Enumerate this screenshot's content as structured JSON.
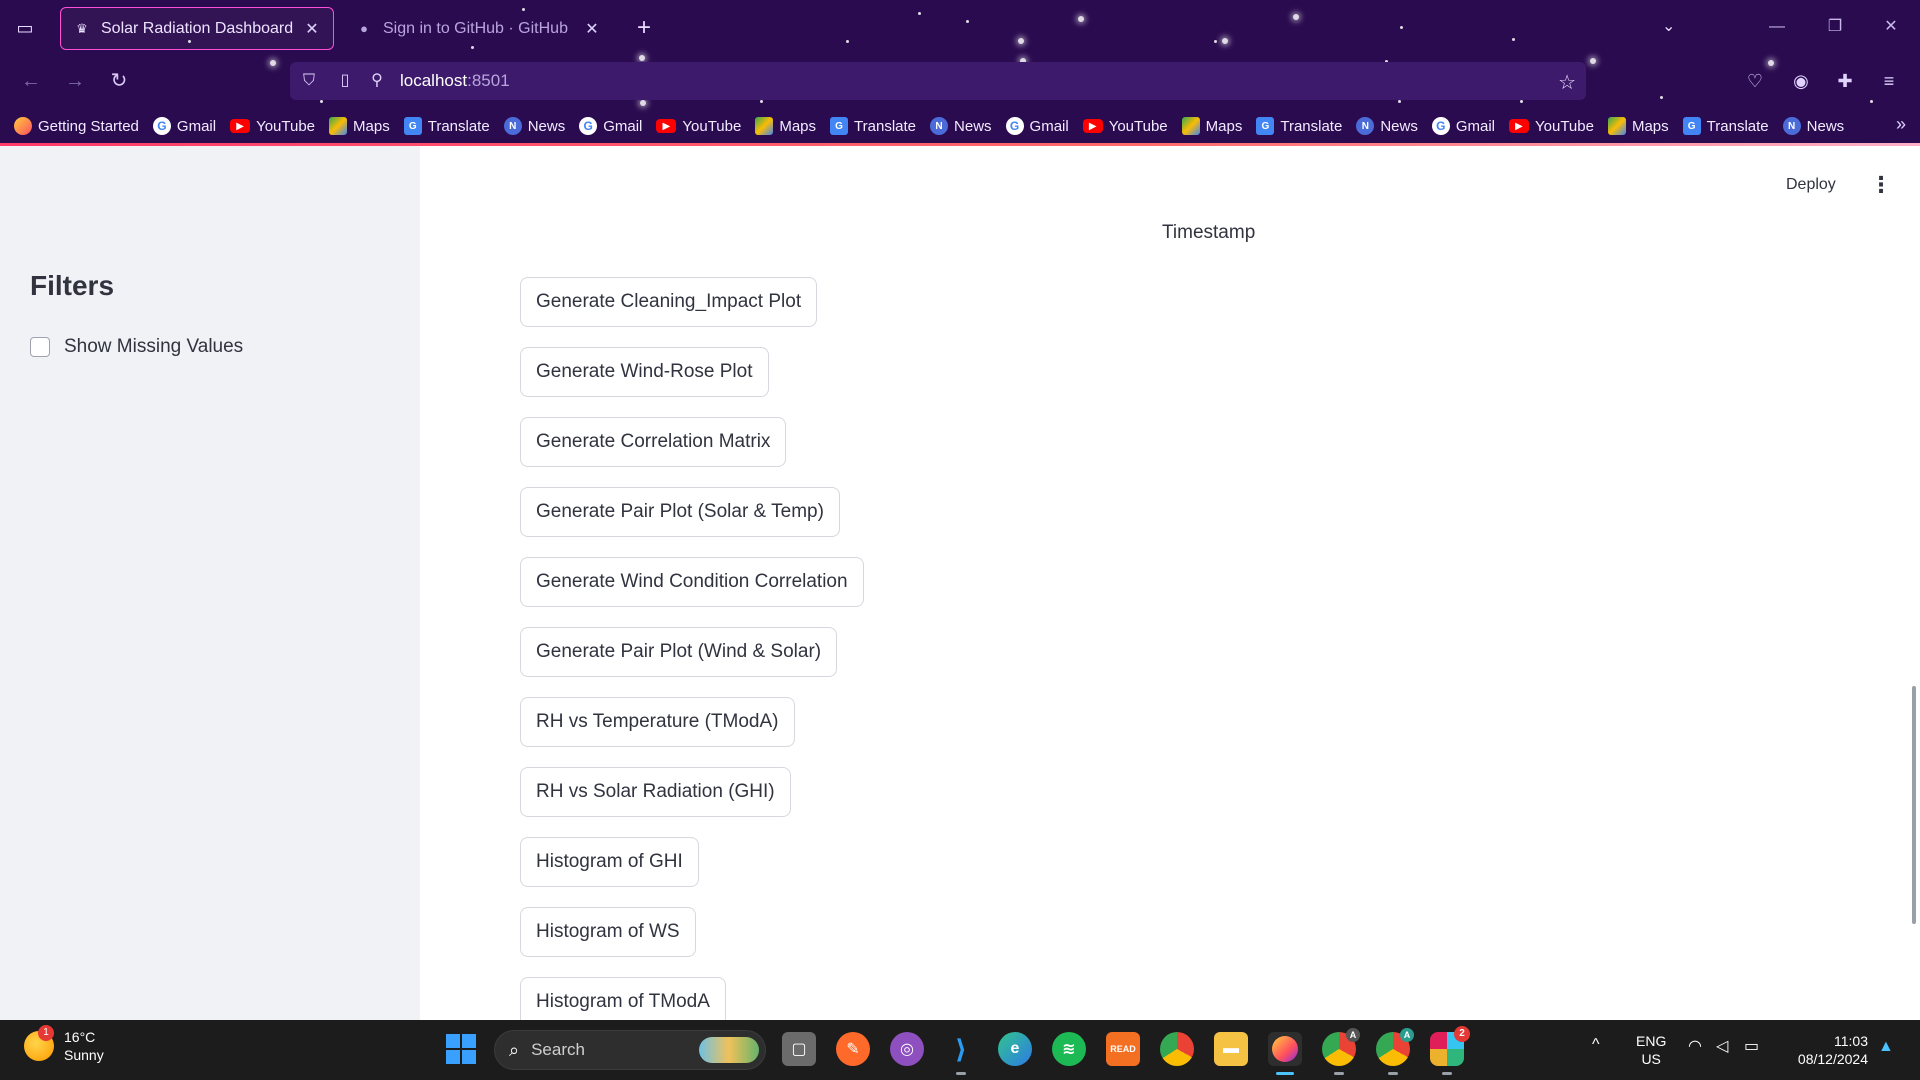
{
  "browser": {
    "tabs": [
      {
        "title": "Solar Radiation Dashboard",
        "active": true
      },
      {
        "title": "Sign in to GitHub · GitHub",
        "active": false
      }
    ],
    "url_host": "localhost",
    "url_port": ":8501",
    "bookmarks": [
      {
        "label": "Getting Started",
        "icon": "firefox-icon"
      },
      {
        "label": "Gmail",
        "icon": "google-icon"
      },
      {
        "label": "YouTube",
        "icon": "youtube-icon"
      },
      {
        "label": "Maps",
        "icon": "maps-icon"
      },
      {
        "label": "Translate",
        "icon": "translate-icon"
      },
      {
        "label": "News",
        "icon": "news-icon"
      },
      {
        "label": "Gmail",
        "icon": "google-icon"
      },
      {
        "label": "YouTube",
        "icon": "youtube-icon"
      },
      {
        "label": "Maps",
        "icon": "maps-icon"
      },
      {
        "label": "Translate",
        "icon": "translate-icon"
      },
      {
        "label": "News",
        "icon": "news-icon"
      },
      {
        "label": "Gmail",
        "icon": "google-icon"
      },
      {
        "label": "YouTube",
        "icon": "youtube-icon"
      },
      {
        "label": "Maps",
        "icon": "maps-icon"
      },
      {
        "label": "Translate",
        "icon": "translate-icon"
      },
      {
        "label": "News",
        "icon": "news-icon"
      },
      {
        "label": "Gmail",
        "icon": "google-icon"
      },
      {
        "label": "YouTube",
        "icon": "youtube-icon"
      },
      {
        "label": "Maps",
        "icon": "maps-icon"
      },
      {
        "label": "Translate",
        "icon": "translate-icon"
      },
      {
        "label": "News",
        "icon": "news-icon"
      }
    ]
  },
  "sidebar": {
    "title": "Filters",
    "checkbox_label": "Show Missing Values",
    "checked": false
  },
  "main": {
    "deploy_label": "Deploy",
    "timestamp_label": "Timestamp",
    "buttons": [
      "Generate Cleaning_Impact Plot",
      "Generate Wind-Rose Plot",
      "Generate Correlation Matrix",
      "Generate Pair Plot (Solar & Temp)",
      "Generate Wind Condition Correlation",
      "Generate Pair Plot (Wind & Solar)",
      "RH vs Temperature (TModA)",
      "RH vs Solar Radiation (GHI)",
      "Histogram of GHI",
      "Histogram of WS",
      "Histogram of TModA"
    ]
  },
  "taskbar": {
    "weather_temp": "16°C",
    "weather_desc": "Sunny",
    "weather_badge": "1",
    "search_placeholder": "Search",
    "lang_1": "ENG",
    "lang_2": "US",
    "time": "11:03",
    "date": "08/12/2024",
    "slack_badge": "2",
    "chrome_profile_a": "A",
    "chrome_profile_b": "A"
  },
  "colors": {
    "chrome_bg": "#2a0b4f",
    "active_tab_border": "#ff4fd8",
    "sidebar_bg": "#f0f2f6",
    "text": "#31333f"
  }
}
